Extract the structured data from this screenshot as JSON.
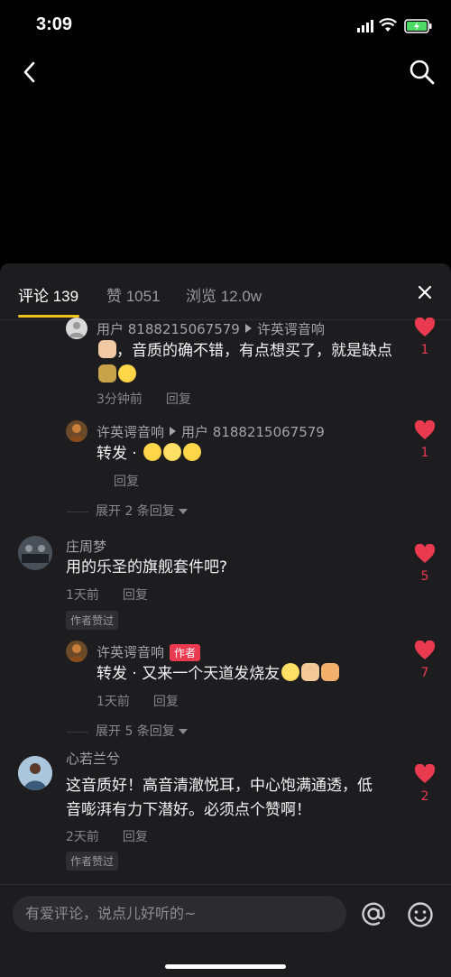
{
  "status": {
    "time": "3:09"
  },
  "tabs": {
    "comments": "评论 139",
    "likes": "赞 1051",
    "views": "浏览 12.0w"
  },
  "comments": [
    {
      "user": "用户 8188215067579",
      "reply_to": "许英谔音响",
      "text": "，音质的确不错，有点想买了，就是缺点",
      "time": "3分钟前",
      "reply": "回复",
      "likes": "1"
    },
    {
      "user": "许英谔音响",
      "reply_to": "用户 8188215067579",
      "text": "转发 ·",
      "reply": "回复",
      "likes": "1"
    },
    {
      "expand": "展开 2 条回复"
    },
    {
      "user": "庄周梦",
      "text": "用的乐圣的旗舰套件吧?",
      "time": "1天前",
      "reply": "回复",
      "liked_by_author": "作者赞过",
      "likes": "5"
    },
    {
      "user": "许英谔音响",
      "badge": "作者",
      "text": "转发 · 又来一个天道发烧友",
      "time": "1天前",
      "reply": "回复",
      "likes": "7"
    },
    {
      "expand": "展开 5 条回复"
    },
    {
      "user": "心若兰兮",
      "text_line1": "这音质好！高音清澈悦耳，中心饱满通透，低",
      "text_line2": "音嘭湃有力下潜好。必须点个赞啊！",
      "time": "2天前",
      "reply": "回复",
      "liked_by_author": "作者赞过",
      "likes": "2"
    }
  ],
  "input": {
    "placeholder": "有爱评论，说点儿好听的~"
  },
  "colors": {
    "accent": "#f0c419",
    "like": "#e93a4f",
    "sheet_bg": "#1d1d1f"
  }
}
